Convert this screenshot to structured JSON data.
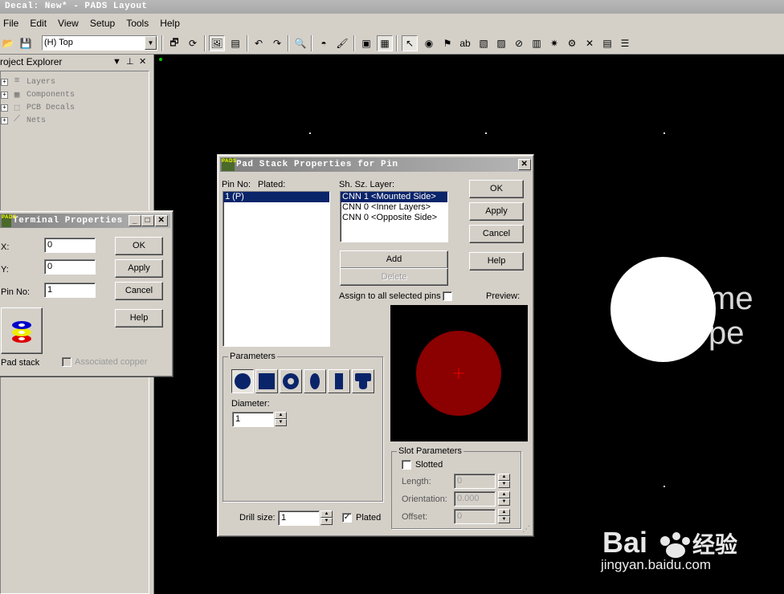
{
  "window": {
    "title": "Decal: New* - PADS Layout"
  },
  "menu": [
    "File",
    "Edit",
    "View",
    "Setup",
    "Tools",
    "Help"
  ],
  "toolbar": {
    "layer_selected": "(H) Top"
  },
  "explorer": {
    "title": "roject Explorer",
    "items": [
      "Layers",
      "Components",
      "PCB Decals",
      "Nets"
    ]
  },
  "terminal_dialog": {
    "title": "Terminal Properties",
    "x_label": "X:",
    "x_value": "0",
    "y_label": "Y:",
    "y_value": "0",
    "pin_label": "Pin No:",
    "pin_value": "1",
    "ok": "OK",
    "apply": "Apply",
    "cancel": "Cancel",
    "help": "Help",
    "pad_stack": "Pad stack",
    "associated_copper": "Associated copper"
  },
  "pad_dialog": {
    "title": "Pad Stack Properties for Pin",
    "pin_no_label": "Pin No:",
    "plated_label": "Plated:",
    "pins": [
      "1 (P)"
    ],
    "layer_header": "Sh. Sz. Layer:",
    "layers": [
      "CNN 1 <Mounted Side>",
      "CNN 0 <Inner Layers>",
      "CNN 0 <Opposite Side>"
    ],
    "add": "Add",
    "delete": "Delete",
    "assign_all": "Assign to all selected pins",
    "preview_label": "Preview:",
    "ok": "OK",
    "apply": "Apply",
    "cancel": "Cancel",
    "help": "Help",
    "parameters_title": "Parameters",
    "diameter_label": "Diameter:",
    "diameter_value": "1",
    "slot_title": "Slot Parameters",
    "slotted": "Slotted",
    "length_label": "Length:",
    "length_value": "0",
    "orientation_label": "Orientation:",
    "orientation_value": "0.000",
    "offset_label": "Offset:",
    "offset_value": "0",
    "drill_label": "Drill size:",
    "drill_value": "1",
    "plated_check_label": "Plated",
    "plated_checked": true
  },
  "canvas": {
    "ghost_text": [
      "me",
      "pe"
    ]
  },
  "watermark": {
    "brand": "Baidu 经验",
    "url": "jingyan.baidu.com"
  },
  "colors": {
    "pad_fill": "#8b0000",
    "selection": "#0a246a",
    "dialog_bg": "#d4d0c8"
  }
}
